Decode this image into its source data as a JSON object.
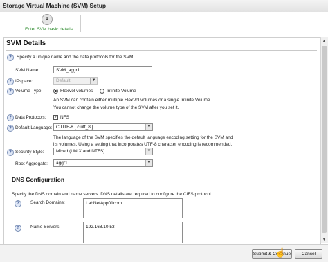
{
  "window": {
    "title": "Storage Virtual Machine (SVM) Setup"
  },
  "steps": [
    {
      "number": "1",
      "label": "Enter SVM basic details"
    }
  ],
  "svm_section": {
    "title": "SVM Details",
    "intro": "Specify a unique name and the data protocols for the SVM",
    "svm_name": {
      "label": "SVM Name:",
      "value": "SVM_aggr1"
    },
    "ipspace": {
      "label": "IPspace:",
      "value": "Default"
    },
    "volume_type": {
      "label": "Volume Type:",
      "options": [
        "FlexVol volumes",
        "Infinite Volume"
      ],
      "selected": "FlexVol volumes",
      "note1": "An SVM can contain either multiple FlexVol volumes or a single Infinite Volume.",
      "note2": "You cannot change the volume type of the SVM after you set it."
    },
    "data_protocols": {
      "label": "Data Protocols:",
      "option": "NFS",
      "checked": true
    },
    "default_language": {
      "label": "Default Language:",
      "value": "C.UTF-8 [ c.utf_8 ]",
      "note1": "The language of the SVM specifies the default language encoding setting for the SVM and",
      "note2": "its volumes. Using a setting that incorporates UTF-8 character encoding is recommended."
    },
    "security_style": {
      "label": "Security Style:",
      "value": "Mixed (UNIX and NTFS)"
    },
    "root_aggregate": {
      "label": "Root Aggregate:",
      "value": "aggr1"
    }
  },
  "dns_section": {
    "title": "DNS Configuration",
    "intro": "Specify the DNS domain and name servers. DNS details are required to configure the CIFS protocol.",
    "search_domains": {
      "label": "Search Domains:",
      "value": "LabNetApp01com"
    },
    "name_servers": {
      "label": "Name Servers:",
      "value": "192.168.10.53"
    }
  },
  "footer": {
    "submit_label": "Submit & Continue",
    "cancel_label": "Cancel"
  },
  "help_glyph": "?"
}
